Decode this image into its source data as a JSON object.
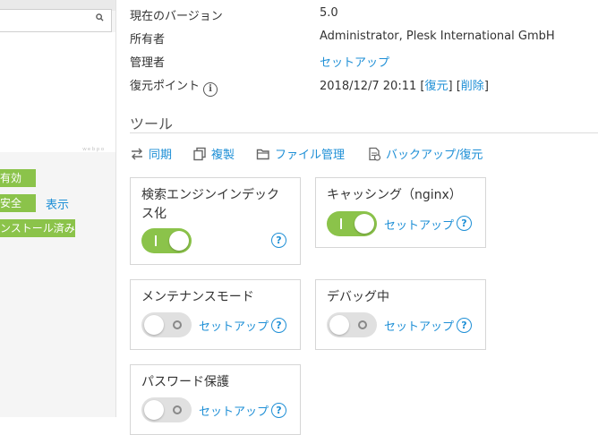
{
  "sidebar": {
    "search_icon": "search-icon",
    "tiny_text": "ｗｅｂｐｏ",
    "badges": [
      "有効",
      "安全",
      "ンストール済み"
    ],
    "show_link": "表示",
    "badge_color": "#8bc34a"
  },
  "info": {
    "version_label": "現在のバージョン",
    "version_value": "5.0",
    "owner_label": "所有者",
    "owner_value": "Administrator, Plesk International GmbH",
    "admin_label": "管理者",
    "admin_value": "セットアップ",
    "restore_label": "復元ポイント",
    "restore_date": "2018/12/7 20:11",
    "restore_link": "復元",
    "delete_link": "削除",
    "bracket_open": "[",
    "bracket_close": "]"
  },
  "tools": {
    "title": "ツール",
    "sync": "同期",
    "clone": "複製",
    "file_manager": "ファイル管理",
    "backup": "バックアップ/復元"
  },
  "cards": {
    "indexing": {
      "title": "検索エンジンインデックス化",
      "toggle_on": true
    },
    "caching": {
      "title": "キャッシング（nginx）",
      "toggle_on": true,
      "link": "セットアップ"
    },
    "maintenance": {
      "title": "メンテナンスモード",
      "toggle_on": false,
      "link": "セットアップ"
    },
    "debug": {
      "title": "デバッグ中",
      "toggle_on": false,
      "link": "セットアップ"
    },
    "password": {
      "title": "パスワード保護",
      "toggle_on": false,
      "link": "セットアップ"
    }
  },
  "help_glyph": "?",
  "info_glyph": "i",
  "colors": {
    "link": "#1e8fd6",
    "toggle_on": "#8bc34a",
    "toggle_off": "#e0e0e0"
  }
}
